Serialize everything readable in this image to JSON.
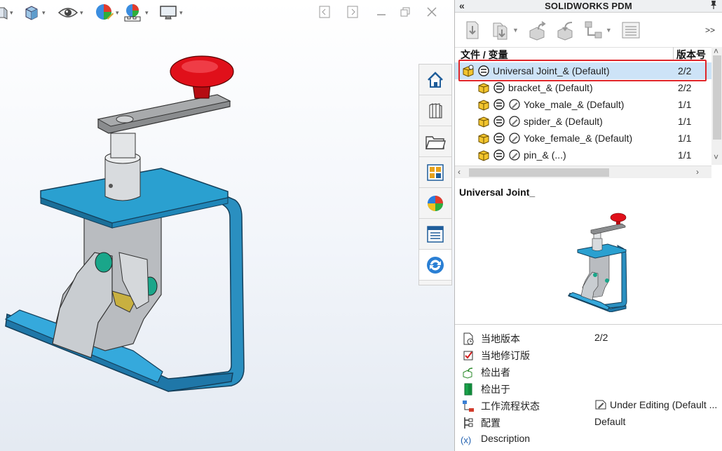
{
  "panel": {
    "title": "SOLIDWORKS PDM",
    "collapse_glyph": "«",
    "pin_glyph": "📌",
    "more_glyph": ">>"
  },
  "file_list": {
    "col_name": "文件 / 变量",
    "col_version": "版本号",
    "rows": [
      {
        "name": "Universal Joint_&  (Default)",
        "version": "2/2",
        "selected": true
      },
      {
        "name": "bracket_&  (Default)",
        "version": "2/2"
      },
      {
        "name": "Yoke_male_&  (Default)",
        "version": "1/1"
      },
      {
        "name": "spider_&  (Default)",
        "version": "1/1"
      },
      {
        "name": "Yoke_female_&  (Default)",
        "version": "1/1"
      },
      {
        "name": "pin_&  (...)",
        "version": "1/1"
      }
    ]
  },
  "preview": {
    "title": "Universal Joint_"
  },
  "properties": [
    {
      "icon": "local-version-icon",
      "label": "当地版本",
      "value": "2/2"
    },
    {
      "icon": "local-revision-icon",
      "label": "当地修订版",
      "value": ""
    },
    {
      "icon": "checked-out-by-icon",
      "label": "检出者",
      "value": ""
    },
    {
      "icon": "checked-out-in-icon",
      "label": "检出于",
      "value": ""
    },
    {
      "icon": "workflow-state-icon",
      "label": "工作流程状态",
      "value": "Under Editing (Default ..."
    },
    {
      "icon": "configuration-icon",
      "label": "配置",
      "value": "Default"
    },
    {
      "icon": "variable-icon",
      "label": "Description",
      "value": "",
      "prefix": "(x)"
    }
  ],
  "colors": {
    "accent": "#1f88c6",
    "selection_bg": "#cde3f7",
    "highlight_box": "#e0262a",
    "part_blue": "#2aa0d0",
    "knob_red": "#e0101a"
  }
}
